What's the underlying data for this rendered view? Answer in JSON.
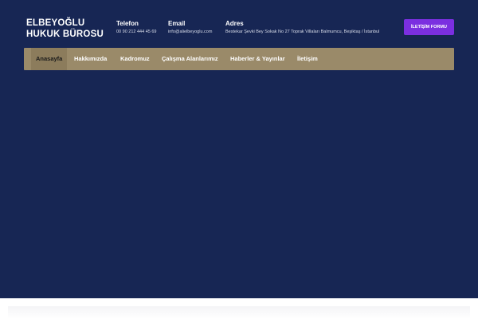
{
  "brand": {
    "line1": "ELBEYOĞLU",
    "line2": "HUKUK BÜROSU"
  },
  "contact": {
    "phone_title": "Telefon",
    "phone_value": "00 90 212 444 45 69",
    "email_title": "Email",
    "email_value": "info@alielbeyoglu.com",
    "address_title": "Adres",
    "address_value": "Bestekar Şevki Bey Sokak No 27 Toprak Villaları Balmumcu, Beşiktaş / İstanbul"
  },
  "cta": {
    "label": "İLETİŞİM FORMU"
  },
  "nav": {
    "items": [
      {
        "label": "Anasayfa"
      },
      {
        "label": "Hakkımızda"
      },
      {
        "label": "Kadromuz"
      },
      {
        "label": "Çalışma Alanlarımız"
      },
      {
        "label": "Haberler & Yayınlar"
      },
      {
        "label": "İletişim"
      }
    ]
  },
  "colors": {
    "hero_background": "#172654",
    "nav_background": "#9a8a69",
    "cta_background": "#7b2fe0"
  }
}
